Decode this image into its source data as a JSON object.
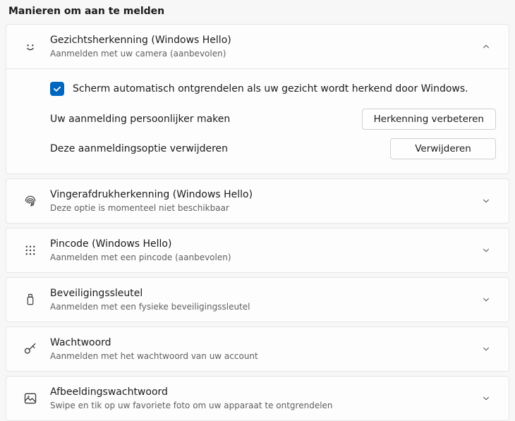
{
  "section_title": "Manieren om aan te melden",
  "face": {
    "title": "Gezichtsherkenning (Windows Hello)",
    "subtitle": "Aanmelden met uw camera (aanbevolen)",
    "checkbox_label": "Scherm automatisch ontgrendelen als uw gezicht wordt herkend door Windows.",
    "checkbox_checked": true,
    "improve_label": "Uw aanmelding persoonlijker maken",
    "improve_button": "Herkenning verbeteren",
    "remove_label": "Deze aanmeldingsoptie verwijderen",
    "remove_button": "Verwijderen"
  },
  "fingerprint": {
    "title": "Vingerafdrukherkenning (Windows Hello)",
    "subtitle": "Deze optie is momenteel niet beschikbaar"
  },
  "pin": {
    "title": "Pincode (Windows Hello)",
    "subtitle": "Aanmelden met een pincode (aanbevolen)"
  },
  "securitykey": {
    "title": "Beveiligingssleutel",
    "subtitle": "Aanmelden met een fysieke beveiligingssleutel"
  },
  "password": {
    "title": "Wachtwoord",
    "subtitle": "Aanmelden met het wachtwoord van uw account"
  },
  "picturepassword": {
    "title": "Afbeeldingswachtwoord",
    "subtitle": "Swipe en tik op uw favoriete foto om uw apparaat te ontgrendelen"
  }
}
